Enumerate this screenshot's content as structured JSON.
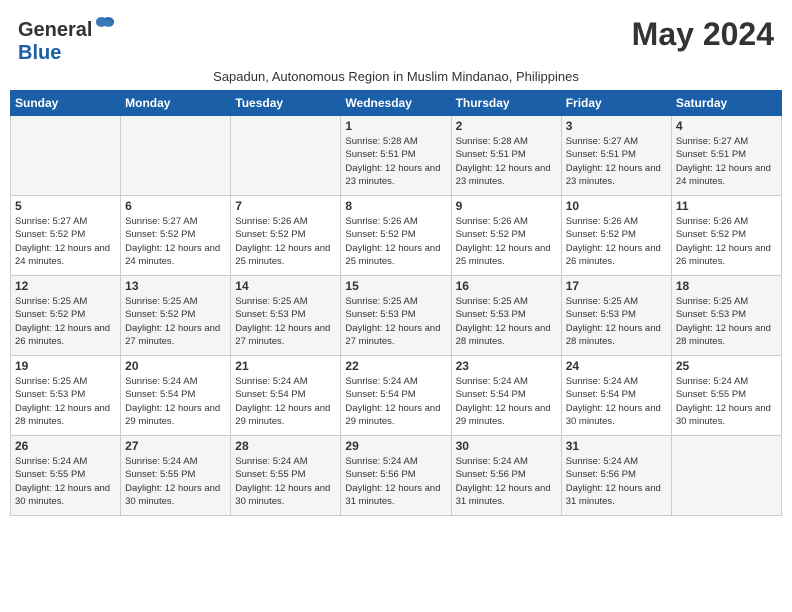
{
  "header": {
    "logo_general": "General",
    "logo_blue": "Blue",
    "month_title": "May 2024",
    "subtitle": "Sapadun, Autonomous Region in Muslim Mindanao, Philippines"
  },
  "weekdays": [
    "Sunday",
    "Monday",
    "Tuesday",
    "Wednesday",
    "Thursday",
    "Friday",
    "Saturday"
  ],
  "weeks": [
    [
      {
        "day": "",
        "sunrise": "",
        "sunset": "",
        "daylight": ""
      },
      {
        "day": "",
        "sunrise": "",
        "sunset": "",
        "daylight": ""
      },
      {
        "day": "",
        "sunrise": "",
        "sunset": "",
        "daylight": ""
      },
      {
        "day": "1",
        "sunrise": "Sunrise: 5:28 AM",
        "sunset": "Sunset: 5:51 PM",
        "daylight": "Daylight: 12 hours and 23 minutes."
      },
      {
        "day": "2",
        "sunrise": "Sunrise: 5:28 AM",
        "sunset": "Sunset: 5:51 PM",
        "daylight": "Daylight: 12 hours and 23 minutes."
      },
      {
        "day": "3",
        "sunrise": "Sunrise: 5:27 AM",
        "sunset": "Sunset: 5:51 PM",
        "daylight": "Daylight: 12 hours and 23 minutes."
      },
      {
        "day": "4",
        "sunrise": "Sunrise: 5:27 AM",
        "sunset": "Sunset: 5:51 PM",
        "daylight": "Daylight: 12 hours and 24 minutes."
      }
    ],
    [
      {
        "day": "5",
        "sunrise": "Sunrise: 5:27 AM",
        "sunset": "Sunset: 5:52 PM",
        "daylight": "Daylight: 12 hours and 24 minutes."
      },
      {
        "day": "6",
        "sunrise": "Sunrise: 5:27 AM",
        "sunset": "Sunset: 5:52 PM",
        "daylight": "Daylight: 12 hours and 24 minutes."
      },
      {
        "day": "7",
        "sunrise": "Sunrise: 5:26 AM",
        "sunset": "Sunset: 5:52 PM",
        "daylight": "Daylight: 12 hours and 25 minutes."
      },
      {
        "day": "8",
        "sunrise": "Sunrise: 5:26 AM",
        "sunset": "Sunset: 5:52 PM",
        "daylight": "Daylight: 12 hours and 25 minutes."
      },
      {
        "day": "9",
        "sunrise": "Sunrise: 5:26 AM",
        "sunset": "Sunset: 5:52 PM",
        "daylight": "Daylight: 12 hours and 25 minutes."
      },
      {
        "day": "10",
        "sunrise": "Sunrise: 5:26 AM",
        "sunset": "Sunset: 5:52 PM",
        "daylight": "Daylight: 12 hours and 26 minutes."
      },
      {
        "day": "11",
        "sunrise": "Sunrise: 5:26 AM",
        "sunset": "Sunset: 5:52 PM",
        "daylight": "Daylight: 12 hours and 26 minutes."
      }
    ],
    [
      {
        "day": "12",
        "sunrise": "Sunrise: 5:25 AM",
        "sunset": "Sunset: 5:52 PM",
        "daylight": "Daylight: 12 hours and 26 minutes."
      },
      {
        "day": "13",
        "sunrise": "Sunrise: 5:25 AM",
        "sunset": "Sunset: 5:52 PM",
        "daylight": "Daylight: 12 hours and 27 minutes."
      },
      {
        "day": "14",
        "sunrise": "Sunrise: 5:25 AM",
        "sunset": "Sunset: 5:53 PM",
        "daylight": "Daylight: 12 hours and 27 minutes."
      },
      {
        "day": "15",
        "sunrise": "Sunrise: 5:25 AM",
        "sunset": "Sunset: 5:53 PM",
        "daylight": "Daylight: 12 hours and 27 minutes."
      },
      {
        "day": "16",
        "sunrise": "Sunrise: 5:25 AM",
        "sunset": "Sunset: 5:53 PM",
        "daylight": "Daylight: 12 hours and 28 minutes."
      },
      {
        "day": "17",
        "sunrise": "Sunrise: 5:25 AM",
        "sunset": "Sunset: 5:53 PM",
        "daylight": "Daylight: 12 hours and 28 minutes."
      },
      {
        "day": "18",
        "sunrise": "Sunrise: 5:25 AM",
        "sunset": "Sunset: 5:53 PM",
        "daylight": "Daylight: 12 hours and 28 minutes."
      }
    ],
    [
      {
        "day": "19",
        "sunrise": "Sunrise: 5:25 AM",
        "sunset": "Sunset: 5:53 PM",
        "daylight": "Daylight: 12 hours and 28 minutes."
      },
      {
        "day": "20",
        "sunrise": "Sunrise: 5:24 AM",
        "sunset": "Sunset: 5:54 PM",
        "daylight": "Daylight: 12 hours and 29 minutes."
      },
      {
        "day": "21",
        "sunrise": "Sunrise: 5:24 AM",
        "sunset": "Sunset: 5:54 PM",
        "daylight": "Daylight: 12 hours and 29 minutes."
      },
      {
        "day": "22",
        "sunrise": "Sunrise: 5:24 AM",
        "sunset": "Sunset: 5:54 PM",
        "daylight": "Daylight: 12 hours and 29 minutes."
      },
      {
        "day": "23",
        "sunrise": "Sunrise: 5:24 AM",
        "sunset": "Sunset: 5:54 PM",
        "daylight": "Daylight: 12 hours and 29 minutes."
      },
      {
        "day": "24",
        "sunrise": "Sunrise: 5:24 AM",
        "sunset": "Sunset: 5:54 PM",
        "daylight": "Daylight: 12 hours and 30 minutes."
      },
      {
        "day": "25",
        "sunrise": "Sunrise: 5:24 AM",
        "sunset": "Sunset: 5:55 PM",
        "daylight": "Daylight: 12 hours and 30 minutes."
      }
    ],
    [
      {
        "day": "26",
        "sunrise": "Sunrise: 5:24 AM",
        "sunset": "Sunset: 5:55 PM",
        "daylight": "Daylight: 12 hours and 30 minutes."
      },
      {
        "day": "27",
        "sunrise": "Sunrise: 5:24 AM",
        "sunset": "Sunset: 5:55 PM",
        "daylight": "Daylight: 12 hours and 30 minutes."
      },
      {
        "day": "28",
        "sunrise": "Sunrise: 5:24 AM",
        "sunset": "Sunset: 5:55 PM",
        "daylight": "Daylight: 12 hours and 30 minutes."
      },
      {
        "day": "29",
        "sunrise": "Sunrise: 5:24 AM",
        "sunset": "Sunset: 5:56 PM",
        "daylight": "Daylight: 12 hours and 31 minutes."
      },
      {
        "day": "30",
        "sunrise": "Sunrise: 5:24 AM",
        "sunset": "Sunset: 5:56 PM",
        "daylight": "Daylight: 12 hours and 31 minutes."
      },
      {
        "day": "31",
        "sunrise": "Sunrise: 5:24 AM",
        "sunset": "Sunset: 5:56 PM",
        "daylight": "Daylight: 12 hours and 31 minutes."
      },
      {
        "day": "",
        "sunrise": "",
        "sunset": "",
        "daylight": ""
      }
    ]
  ]
}
